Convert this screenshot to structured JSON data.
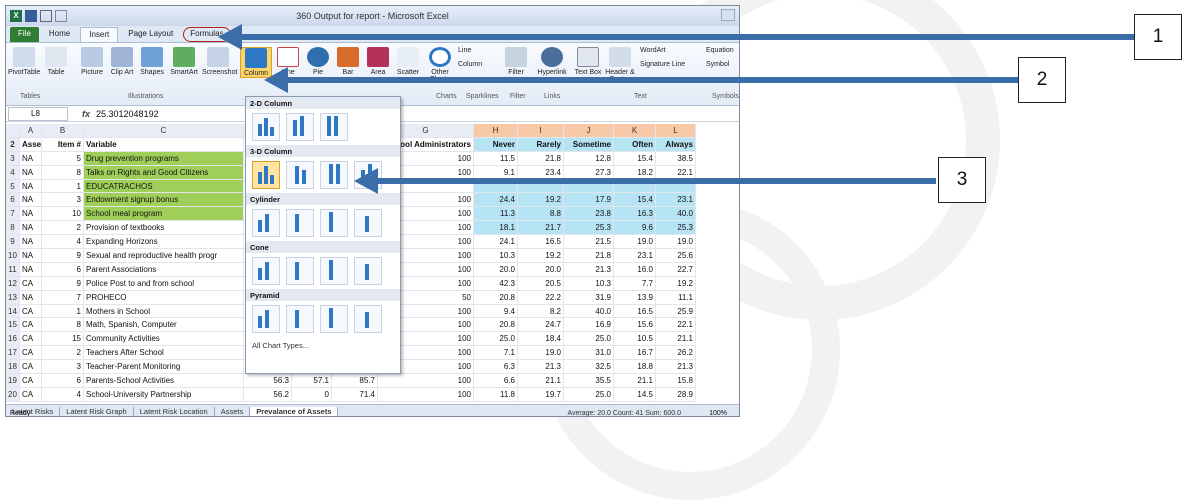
{
  "window": {
    "title": "360 Output for report - Microsoft Excel"
  },
  "ribbon_tabs": [
    "File",
    "Home",
    "Insert",
    "Page Layout",
    "Formulas"
  ],
  "ribbon": {
    "buttons": [
      "PivotTable",
      "Table",
      "Picture",
      "Clip Art",
      "Shapes",
      "SmartArt",
      "Screenshot",
      "Column",
      "Line",
      "Pie",
      "Bar",
      "Area",
      "Scatter",
      "Other Charts",
      "Line",
      "Column",
      "Filter",
      "Hyperlink",
      "Text Box",
      "Header & Footer",
      "WordArt",
      "Signature Line",
      "Equation",
      "Symbol"
    ],
    "groups": [
      "Tables",
      "Illustrations",
      "Charts",
      "Sparklines",
      "Filter",
      "Links",
      "Text",
      "Symbols"
    ]
  },
  "formula_bar": {
    "name_box": "L8",
    "fx": "fx",
    "value": "25.3012048192"
  },
  "columns": [
    "A",
    "B",
    "C",
    "G",
    "H",
    "I",
    "J",
    "K",
    "L"
  ],
  "header_row": {
    "num": "2",
    "A": "Asset",
    "B": "Item #",
    "C": "Variable",
    "G": "School Administrators",
    "H": "Never",
    "I": "Rarely",
    "J": "Sometime",
    "K": "Often",
    "L": "Always"
  },
  "rows": [
    {
      "num": "3",
      "A": "NA",
      "B": "5",
      "C": "Drug prevention programs",
      "D": "",
      "E": "",
      "F": "",
      "G": "100",
      "H": "11.5",
      "I": "21.8",
      "J": "12.8",
      "K": "15.4",
      "L": "38.5"
    },
    {
      "num": "4",
      "A": "NA",
      "B": "8",
      "C": "Talks on Rights and Good Citizens",
      "D": "",
      "E": "",
      "F": "",
      "G": "100",
      "H": "9.1",
      "I": "23.4",
      "J": "27.3",
      "K": "18.2",
      "L": "22.1"
    },
    {
      "num": "5",
      "A": "NA",
      "B": "1",
      "C": "EDUCATRACHOS",
      "D": "",
      "E": "",
      "F": "",
      "G": "",
      "H": "",
      "I": "",
      "J": "",
      "K": "",
      "L": ""
    },
    {
      "num": "6",
      "A": "NA",
      "B": "3",
      "C": "Endowment signup bonus",
      "D": "",
      "E": "",
      "F": "",
      "G": "100",
      "H": "24.4",
      "I": "19.2",
      "J": "17.9",
      "K": "15.4",
      "L": "23.1"
    },
    {
      "num": "7",
      "A": "NA",
      "B": "10",
      "C": "School meal program",
      "D": "",
      "E": "",
      "F": "",
      "G": "100",
      "H": "11.3",
      "I": "8.8",
      "J": "23.8",
      "K": "16.3",
      "L": "40.0"
    },
    {
      "num": "8",
      "A": "NA",
      "B": "2",
      "C": "Provision of textbooks",
      "D": "",
      "E": "",
      "F": "",
      "G": "100",
      "H": "18.1",
      "I": "21.7",
      "J": "25.3",
      "K": "9.6",
      "L": "25.3"
    },
    {
      "num": "9",
      "A": "NA",
      "B": "4",
      "C": "Expanding Horizons",
      "D": "",
      "E": "",
      "F": "",
      "G": "100",
      "H": "24.1",
      "I": "16.5",
      "J": "21.5",
      "K": "19.0",
      "L": "19.0"
    },
    {
      "num": "10",
      "A": "NA",
      "B": "9",
      "C": "Sexual and reproductive health progr",
      "D": "",
      "E": "",
      "F": "",
      "G": "100",
      "H": "10.3",
      "I": "19.2",
      "J": "21.8",
      "K": "23.1",
      "L": "25.6"
    },
    {
      "num": "11",
      "A": "NA",
      "B": "6",
      "C": "Parent Associations",
      "D": "",
      "E": "",
      "F": "",
      "G": "100",
      "H": "20.0",
      "I": "20.0",
      "J": "21.3",
      "K": "16.0",
      "L": "22.7"
    },
    {
      "num": "12",
      "A": "CA",
      "B": "9",
      "C": "Police Post to and from school",
      "D": "",
      "E": "",
      "F": "",
      "G": "100",
      "H": "42.3",
      "I": "20.5",
      "J": "10.3",
      "K": "7.7",
      "L": "19.2"
    },
    {
      "num": "13",
      "A": "NA",
      "B": "7",
      "C": "PROHECO",
      "D": "",
      "E": "",
      "F": "",
      "G": "50",
      "H": "20.8",
      "I": "22.2",
      "J": "31.9",
      "K": "13.9",
      "L": "11.1"
    },
    {
      "num": "14",
      "A": "CA",
      "B": "1",
      "C": "Mothers in School",
      "D": "",
      "E": "",
      "F": "",
      "G": "100",
      "H": "9.4",
      "I": "8.2",
      "J": "40.0",
      "K": "16.5",
      "L": "25.9"
    },
    {
      "num": "15",
      "A": "CA",
      "B": "8",
      "C": "Math, Spanish, Computer",
      "D": "",
      "E": "",
      "F": "",
      "G": "100",
      "H": "20.8",
      "I": "24.7",
      "J": "16.9",
      "K": "15.6",
      "L": "22.1"
    },
    {
      "num": "16",
      "A": "CA",
      "B": "15",
      "C": "Community Activities",
      "D": "",
      "E": "",
      "F": "",
      "G": "100",
      "H": "25.0",
      "I": "18.4",
      "J": "25.0",
      "K": "10.5",
      "L": "21.1"
    },
    {
      "num": "17",
      "A": "CA",
      "B": "2",
      "C": "Teachers After School",
      "D": "",
      "E": "",
      "F": "",
      "G": "100",
      "H": "7.1",
      "I": "19.0",
      "J": "31.0",
      "K": "16.7",
      "L": "26.2"
    },
    {
      "num": "18",
      "A": "CA",
      "B": "3",
      "C": "Teacher-Parent Monitoring",
      "D": "",
      "E": "",
      "F": "",
      "G": "100",
      "H": "6.3",
      "I": "21.3",
      "J": "32.5",
      "K": "18.8",
      "L": "21.3"
    },
    {
      "num": "19",
      "A": "CA",
      "B": "6",
      "C": "Parents-School Activities",
      "D": "56.3",
      "E": "57.1",
      "F": "85.7",
      "G": "100",
      "H": "6.6",
      "I": "21.1",
      "J": "35.5",
      "K": "21.1",
      "L": "15.8"
    },
    {
      "num": "20",
      "A": "CA",
      "B": "4",
      "C": "School-University Partnership",
      "D": "56.2",
      "E": "0",
      "F": "71.4",
      "G": "100",
      "H": "11.8",
      "I": "19.7",
      "J": "25.0",
      "K": "14.5",
      "L": "28.9"
    }
  ],
  "dropdown": {
    "sections": [
      "2-D Column",
      "3-D Column",
      "Cylinder",
      "Cone",
      "Pyramid"
    ],
    "all_chart_types": "All Chart Types..."
  },
  "sheet_tabs": [
    "Latent Risks",
    "Latent Risk Graph",
    "Latent Risk Location",
    "Assets",
    "Prevalance of Assets"
  ],
  "status": {
    "left": "Ready",
    "summary": "Average: 20.0   Count: 41   Sum: 600.0",
    "zoom": "100%"
  },
  "callouts": [
    "1",
    "2",
    "3"
  ],
  "colors": {
    "arrow": "#3b6ea8",
    "green_fill": "#9fcf59",
    "blue_fill": "#b7e4f4",
    "selected_button": "#fbd46a",
    "circle_highlight": "#b02020"
  }
}
